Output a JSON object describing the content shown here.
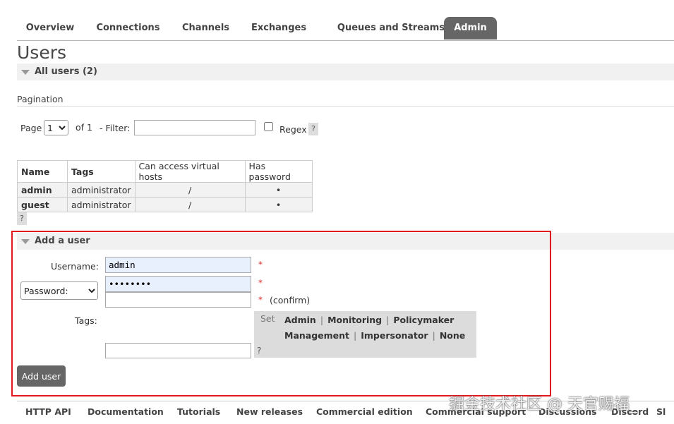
{
  "tabs": [
    {
      "label": "Overview",
      "active": false
    },
    {
      "label": "Connections",
      "active": false
    },
    {
      "label": "Channels",
      "active": false
    },
    {
      "label": "Exchanges",
      "active": false
    },
    {
      "label": "Queues and Streams",
      "active": false
    },
    {
      "label": "Admin",
      "active": true
    }
  ],
  "page_title": "Users",
  "all_users_header": "All users (2)",
  "pagination": {
    "heading": "Pagination",
    "page_label": "Page",
    "page_value": "1",
    "of_label": "of 1",
    "filter_label": "- Filter:",
    "filter_value": "",
    "regex_label": "Regex",
    "help": "?"
  },
  "users_table": {
    "headers": [
      "Name",
      "Tags",
      "Can access virtual hosts",
      "Has password"
    ],
    "rows": [
      [
        "admin",
        "administrator",
        "/",
        "•"
      ],
      [
        "guest",
        "administrator",
        "/",
        "•"
      ]
    ],
    "help": "?"
  },
  "add_user": {
    "header": "Add a user",
    "username_label": "Username:",
    "username_value": "admin",
    "password_mode": "Password:",
    "password_value": "••••••••",
    "confirm_value": "",
    "required_mark": "*",
    "confirm_label": "(confirm)",
    "tags_label": "Tags:",
    "tags_value": "",
    "set_label": "Set",
    "tag_options": [
      "Admin",
      "Monitoring",
      "Policymaker",
      "Management",
      "Impersonator",
      "None"
    ],
    "tags_help": "?",
    "button_label": "Add user"
  },
  "footer_links": [
    "HTTP API",
    "Documentation",
    "Tutorials",
    "New releases",
    "Commercial edition",
    "Commercial support",
    "Discussions",
    "Discord",
    "Sl"
  ],
  "watermark": "掘金技术社区 @ 天官赐福_",
  "colors": {
    "active_tab": "#666666",
    "highlight_border": "#e0191f",
    "required": "#e03030"
  }
}
